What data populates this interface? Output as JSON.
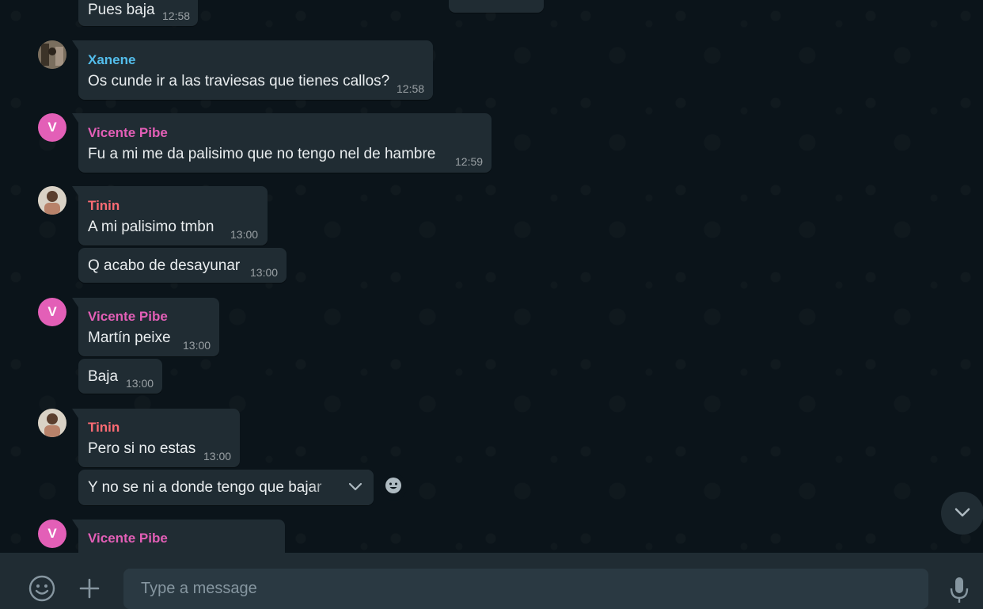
{
  "messages": [
    {
      "sender": "",
      "text": "Pues baja",
      "time": "12:58"
    },
    {
      "sender": "Xanene",
      "text": "Os cunde ir a las traviesas que tienes callos?",
      "time": "12:58"
    },
    {
      "sender": "Vicente Pibe",
      "avatar_letter": "V",
      "text": "Fu a mi me da palisimo que no tengo nel de hambre",
      "time": "12:59"
    },
    {
      "sender": "Tinin",
      "text": "A mi palisimo tmbn",
      "time": "13:00"
    },
    {
      "sender": "",
      "text": "Q acabo de desayunar",
      "time": "13:00"
    },
    {
      "sender": "Vicente Pibe",
      "avatar_letter": "V",
      "text": "Martín peixe",
      "time": "13:00"
    },
    {
      "sender": "",
      "text": "Baja",
      "time": "13:00"
    },
    {
      "sender": "Tinin",
      "text": "Pero si no estas",
      "time": "13:00"
    },
    {
      "sender": "",
      "text": "Y no se ni a donde tengo que bajar",
      "time": ""
    },
    {
      "sender": "Vicente Pibe",
      "avatar_letter": "V",
      "text": "",
      "time": ""
    }
  ],
  "composer": {
    "placeholder": "Type a message"
  },
  "colors": {
    "background": "#0b141a",
    "bubble": "#202c33",
    "composer": "#202c33",
    "input": "#2a3942",
    "sender_blue": "#53bdeb",
    "sender_pink": "#e35fb7",
    "sender_red": "#fc6b73"
  },
  "icons": [
    "emoji-icon",
    "plus-icon",
    "mic-icon",
    "chevron-down-icon",
    "smiley-react-icon"
  ]
}
